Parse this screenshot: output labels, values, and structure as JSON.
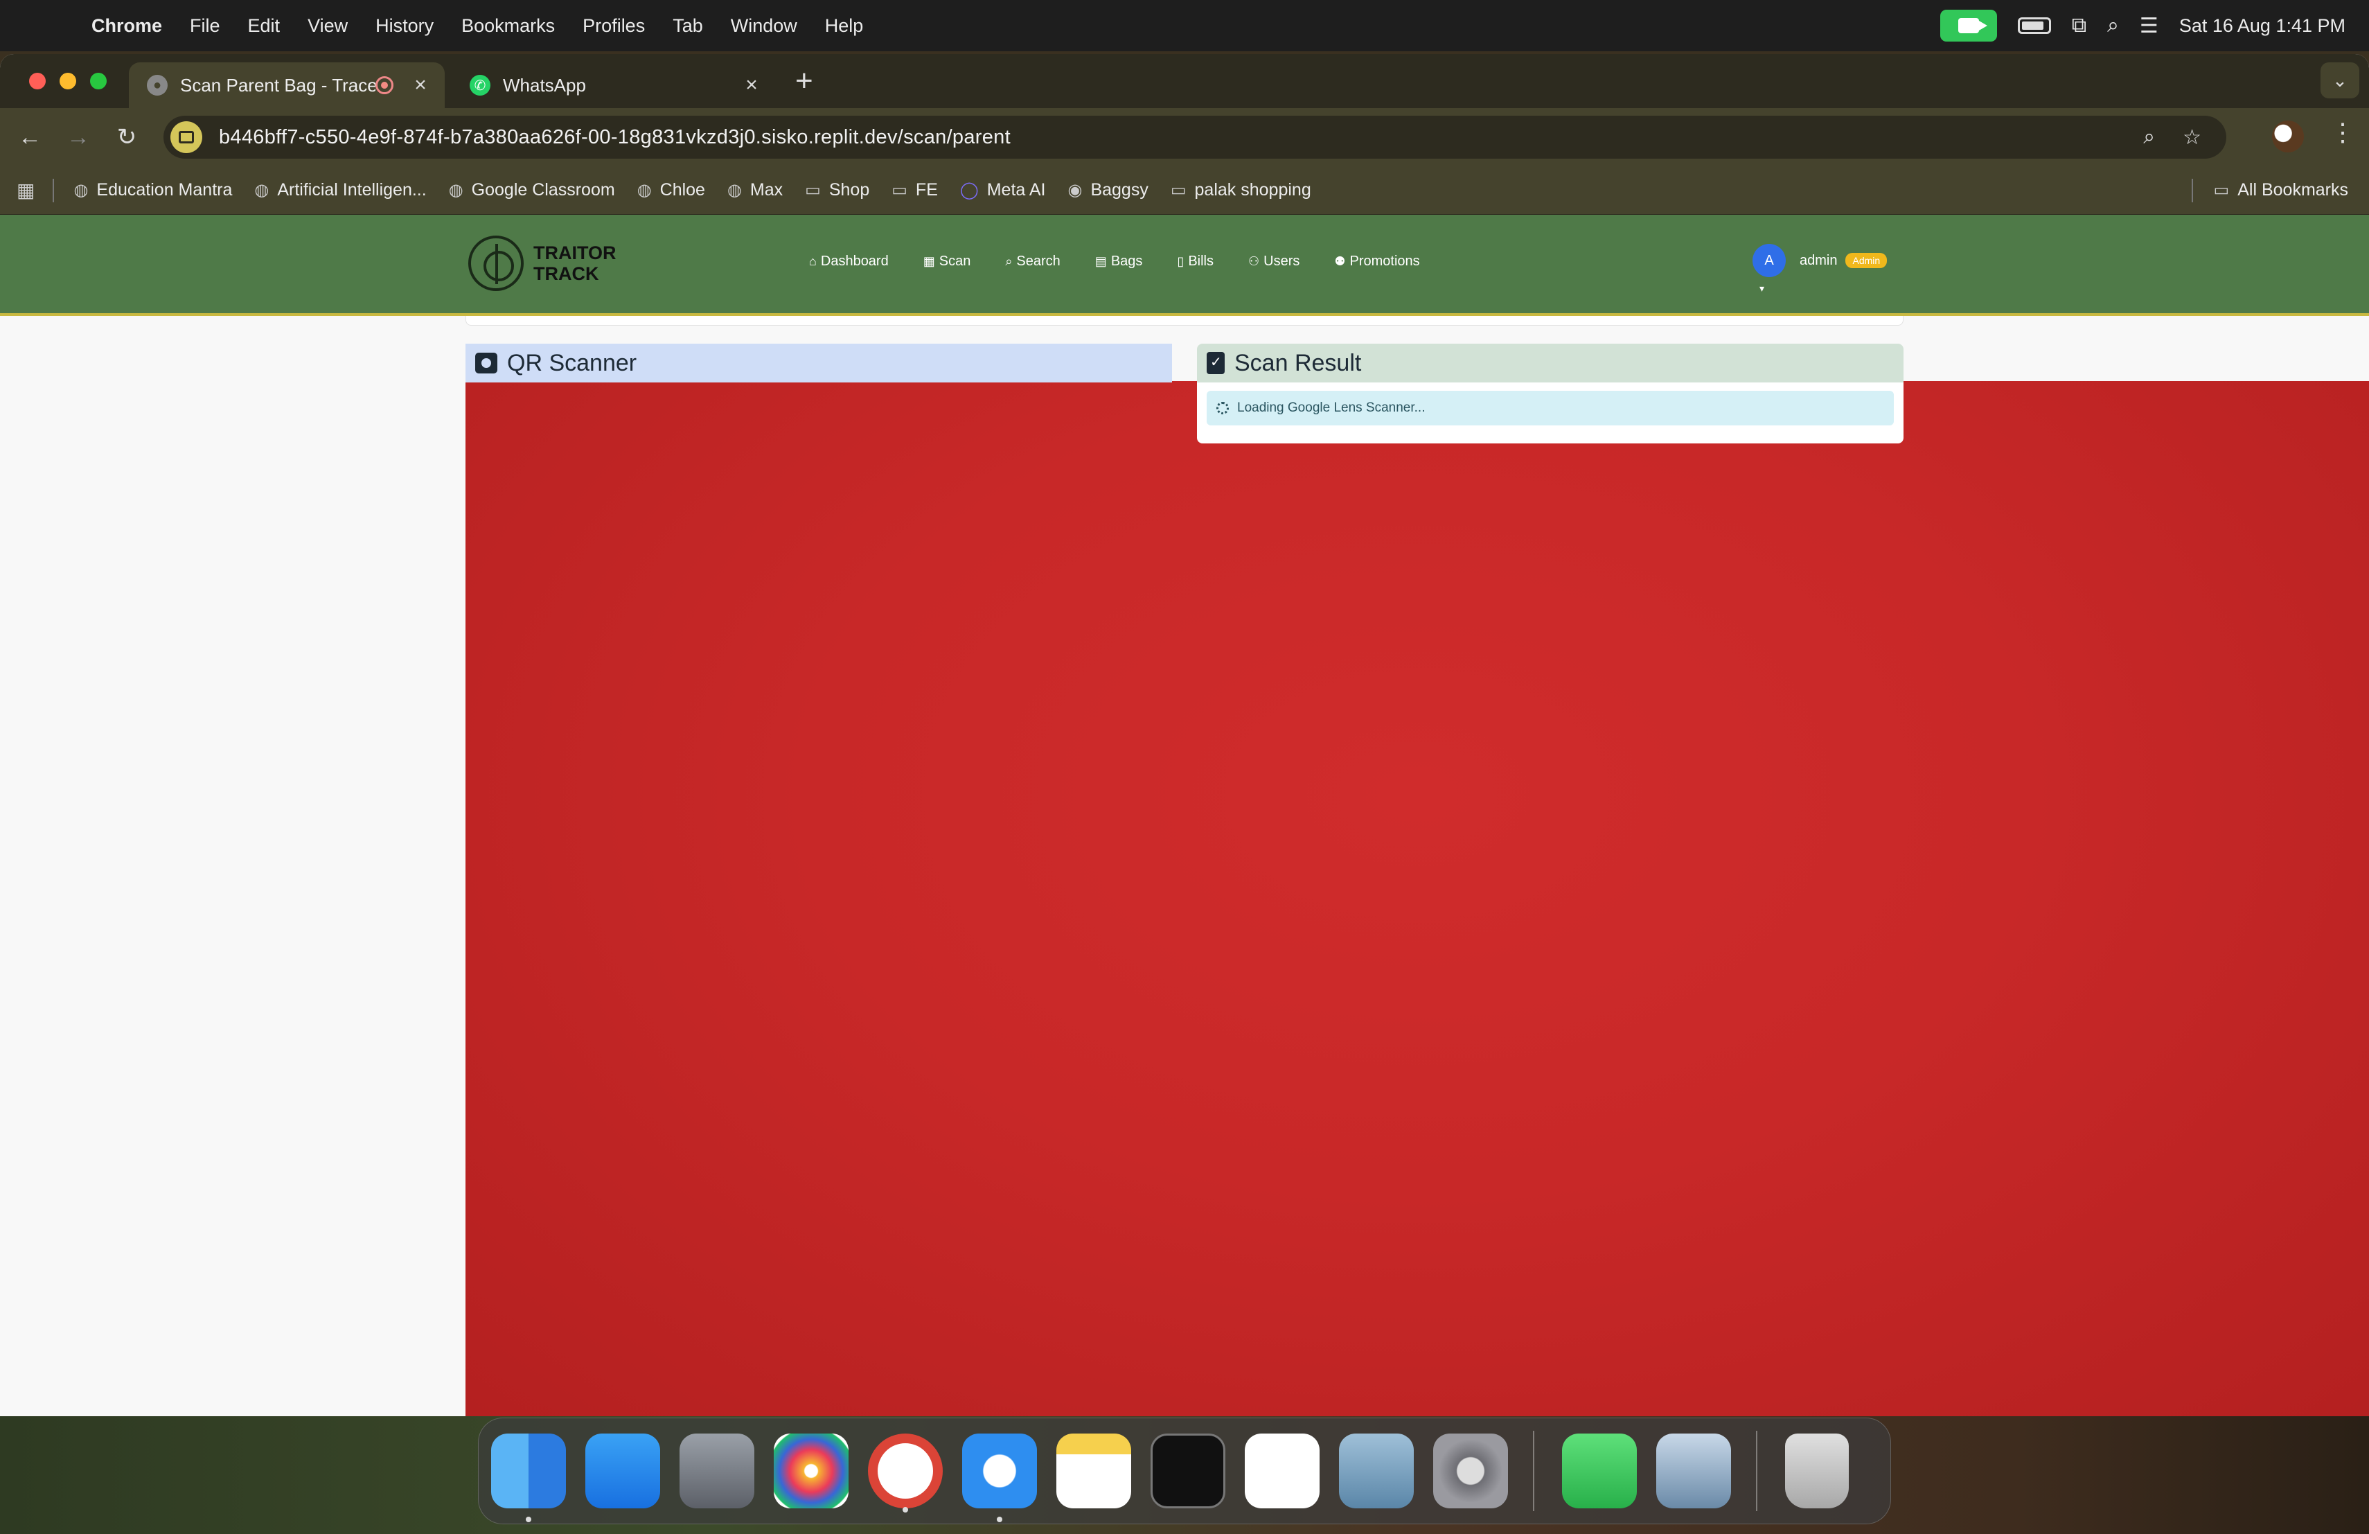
{
  "menubar": {
    "app": "Chrome",
    "items": [
      "File",
      "Edit",
      "View",
      "History",
      "Bookmarks",
      "Profiles",
      "Tab",
      "Window",
      "Help"
    ],
    "clock": "Sat 16 Aug  1:41 PM"
  },
  "browser": {
    "tabs": [
      {
        "title": "Scan Parent Bag - TraceTr",
        "active": true
      },
      {
        "title": "WhatsApp",
        "active": false
      }
    ],
    "url": "b446bff7-c550-4e9f-874f-b7a380aa626f-00-18g831vkzd3j0.sisko.replit.dev/scan/parent",
    "bookmarks": [
      {
        "label": "Education Mantra",
        "icon": "globe-icon"
      },
      {
        "label": "Artificial Intelligen...",
        "icon": "globe-icon"
      },
      {
        "label": "Google Classroom",
        "icon": "globe-icon"
      },
      {
        "label": "Chloe",
        "icon": "globe-icon"
      },
      {
        "label": "Max",
        "icon": "globe-icon"
      },
      {
        "label": "Shop",
        "icon": "folder-icon"
      },
      {
        "label": "FE",
        "icon": "folder-icon"
      },
      {
        "label": "Meta AI",
        "icon": "meta-ai-icon"
      },
      {
        "label": "Baggsy",
        "icon": "baggsy-icon"
      },
      {
        "label": "palak shopping",
        "icon": "folder-icon"
      }
    ],
    "all_bookmarks": "All Bookmarks"
  },
  "app": {
    "brand": "TRAITOR TRACK",
    "nav": [
      {
        "label": "Dashboard",
        "icon": "home-icon"
      },
      {
        "label": "Scan",
        "icon": "grid-icon"
      },
      {
        "label": "Search",
        "icon": "search-icon"
      },
      {
        "label": "Bags",
        "icon": "bags-icon"
      },
      {
        "label": "Bills",
        "icon": "bill-icon"
      },
      {
        "label": "Users",
        "icon": "users-icon"
      },
      {
        "label": "Promotions",
        "icon": "user-gear-icon"
      }
    ],
    "user": {
      "initial": "A",
      "name": "admin",
      "role": "Admin"
    }
  },
  "scanner": {
    "qr_title": "QR Scanner",
    "result_title": "Scan Result",
    "loading_text": "Loading Google Lens Scanner..."
  },
  "colors": {
    "navbar": "#4f7a48",
    "camera_feed": "#c82828",
    "qr_header": "#cfddf7",
    "result_header": "#d2e2d6",
    "loading_bg": "#d5f0f6",
    "role_badge": "#f0b81c"
  },
  "dock": [
    "Finder",
    "App Store",
    "Launchpad",
    "Photos",
    "Google Chrome",
    "Safari",
    "Notes",
    "Terminal",
    "Visual Studio Code",
    "pgAdmin",
    "System Settings",
    "FaceTime",
    "Preview",
    "Trash"
  ]
}
